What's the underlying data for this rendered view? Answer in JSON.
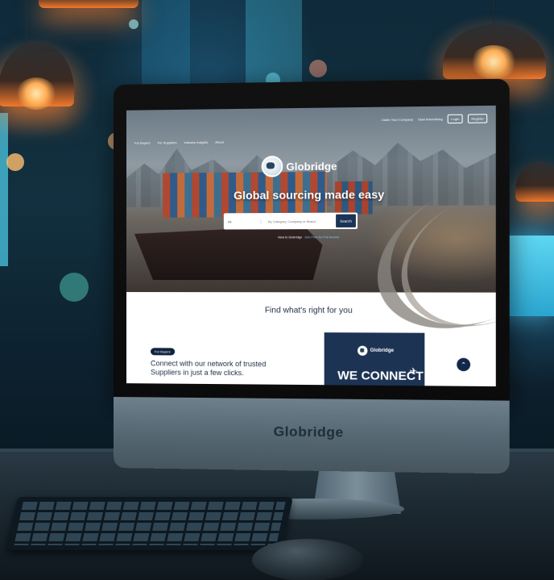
{
  "scene": {
    "monitor_brand": "Globridge"
  },
  "website": {
    "nav": [
      "For Buyers",
      "For Suppliers",
      "Industry Insights",
      "About"
    ],
    "topbar": {
      "claim": "Claim Your Company",
      "advertising": "Start Advertising",
      "login": "Login",
      "register": "Register"
    },
    "logo_text": "Globridge",
    "tagline": "Global sourcing made easy",
    "search": {
      "category": "All",
      "placeholder": "By Category, Company or Brand",
      "button": "Search"
    },
    "new_line": "New to Globridge",
    "new_link": "Join Free for Full Access",
    "find_heading": "Find what's right for you",
    "buyers_pill": "For Buyers",
    "connect_text": "Connect with our network of trusted Suppliers in just a few clicks.",
    "card": {
      "logo_text": "Globridge",
      "headline": "WE CONNECT"
    }
  },
  "colors": {
    "navy": "#1d3354",
    "lamp": "#f0782c",
    "screen_glow": "#5ed6f2"
  }
}
